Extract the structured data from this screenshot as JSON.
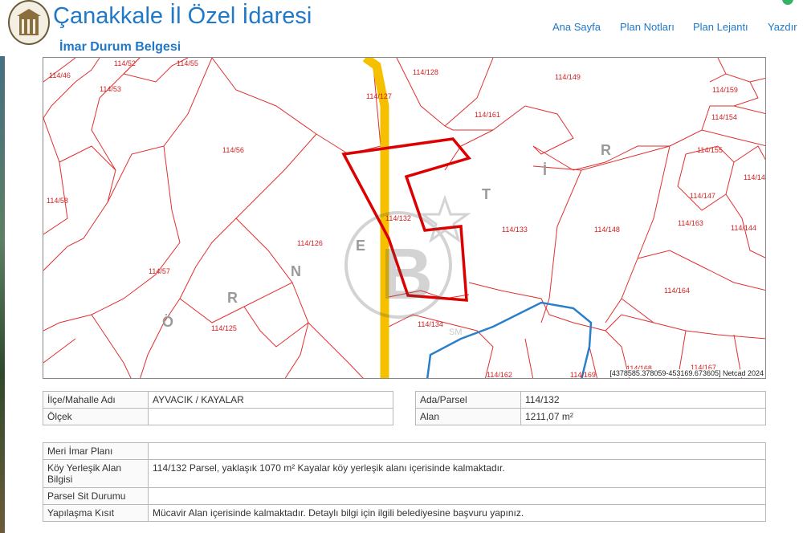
{
  "header": {
    "title": "Çanakkale İl Özel İdaresi",
    "subtitle": "İmar Durum Belgesi",
    "nav": [
      "Ana Sayfa",
      "Plan Notları",
      "Plan Lejantı",
      "Yazdır"
    ]
  },
  "map": {
    "parcel_labels": [
      "114/46",
      "114/52",
      "114/55",
      "114/53",
      "114/127",
      "114/128",
      "114/149",
      "114/159",
      "114/154",
      "114/161",
      "114/56",
      "114/155",
      "114/58",
      "114/14",
      "114/147",
      "114/132",
      "114/133",
      "114/148",
      "114/163",
      "114/144",
      "114/126",
      "114/57",
      "114/164",
      "114/125",
      "114/134",
      "114/162",
      "114/169",
      "114/168",
      "114/167"
    ],
    "place_letters": [
      "Ö",
      "R",
      "N",
      "E",
      "T",
      "İ",
      "R"
    ],
    "coordinates": "[4378585.378059-453169.673605] Netcad 2024",
    "watermark_text": "SM",
    "colors": {
      "parcel_lines": "#e03030",
      "selected_parcel": "#dd0000",
      "road": "#f5c000",
      "stream": "#2a7fc8"
    }
  },
  "table_left": [
    {
      "label": "İlçe/Mahalle Adı",
      "value": "AYVACIK / KAYALAR"
    },
    {
      "label": "Ölçek",
      "value": ""
    }
  ],
  "table_right": [
    {
      "label": "Ada/Parsel",
      "value": "114/132"
    },
    {
      "label": "Alan",
      "value": "1211,07 m²"
    }
  ],
  "table_bottom": [
    {
      "label": "Meri İmar Planı",
      "value": ""
    },
    {
      "label": "Köy Yerleşik Alan Bilgisi",
      "value": "114/132 Parsel, yaklaşık 1070 m² Kayalar köy yerleşik alanı içerisinde kalmaktadır."
    },
    {
      "label": "Parsel Sit Durumu",
      "value": ""
    },
    {
      "label": "Yapılaşma Kısıt",
      "value": "Mücavir Alan içerisinde kalmaktadır. Detaylı bilgi için ilgili belediyesine başvuru yapınız."
    }
  ]
}
